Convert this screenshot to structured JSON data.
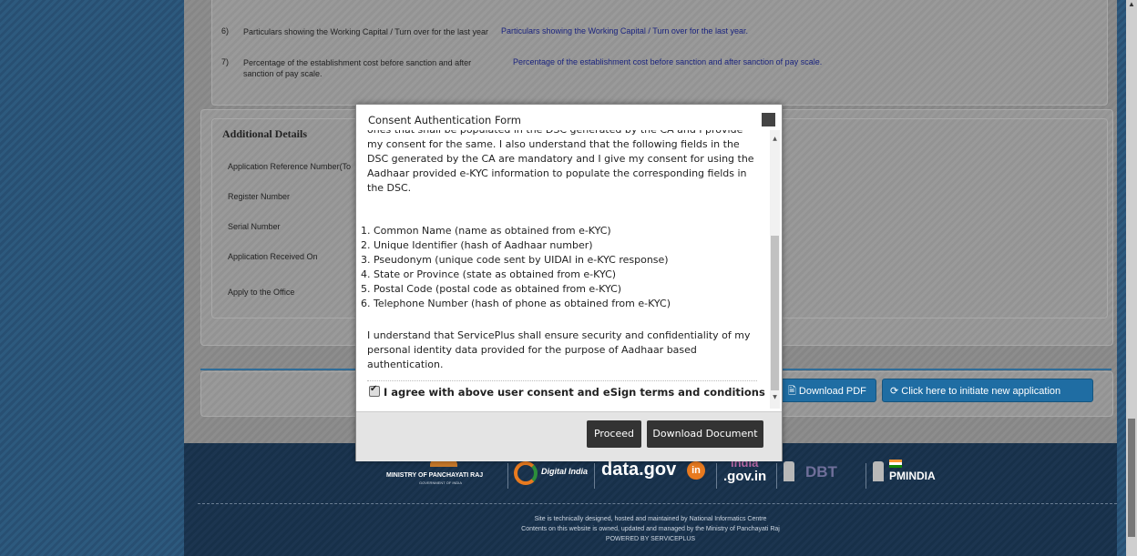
{
  "particulars": [
    {
      "num": "6)",
      "label": "Particulars showing the Working Capital / Turn over for the last year",
      "value": "Particulars showing the Working Capital / Turn over for the last year."
    },
    {
      "num": "7)",
      "label": "Percentage of the establishment cost before sanction and after sanction of pay scale.",
      "value": "Percentage of the establishment cost before sanction and after sanction of pay scale."
    }
  ],
  "additional": {
    "title": "Additional Details",
    "fields": [
      "Application Reference Number(To",
      "Register Number",
      "Serial Number",
      "Application Received On",
      "Apply to the Office"
    ]
  },
  "actions": {
    "download_pdf": "Download PDF",
    "new_application": "Click here to initiate new application"
  },
  "modal": {
    "title": "Consent Authentication Form",
    "para1": "ones that shall be populated in the DSC generated by the CA and I provide my consent for the same. I also understand that the following fields in the DSC generated by the CA are mandatory and I give my consent for using the Aadhaar provided e-KYC information to populate the corresponding fields in the DSC.",
    "list": [
      "1. Common Name (name as obtained from e-KYC)",
      "2. Unique Identifier (hash of Aadhaar number)",
      "3. Pseudonym (unique code sent by UIDAI in e-KYC response)",
      "4. State or Province (state as obtained from e-KYC)",
      "5. Postal Code (postal code as obtained from e-KYC)",
      "6. Telephone Number (hash of phone as obtained from e-KYC)"
    ],
    "para2": "I understand that ServicePlus shall ensure security and confidentiality of my personal identity data provided for the purpose of Aadhaar based authentication.",
    "agree_label": "I agree with above user consent and eSign terms and conditions",
    "proceed": "Proceed",
    "download_document": "Download Document"
  },
  "footer": {
    "logos": {
      "panchayati": "MINISTRY OF PANCHAYATI RAJ",
      "panchayati_sub": "GOVERNMENT OF INDIA",
      "digital_india": "Digital India",
      "datagov": "data.gov",
      "datagov_in": "in",
      "indiagov": ".gov.in",
      "indiagov_top": "india",
      "dbt": "DBT",
      "pmindia": "PMINDIA"
    },
    "line1": "Site is technically designed, hosted and maintained by National Informatics Centre",
    "line2": "Contents on this website is owned, updated and managed by the Ministry of Panchayati Raj",
    "line3": "POWERED BY SERVICEPLUS"
  }
}
